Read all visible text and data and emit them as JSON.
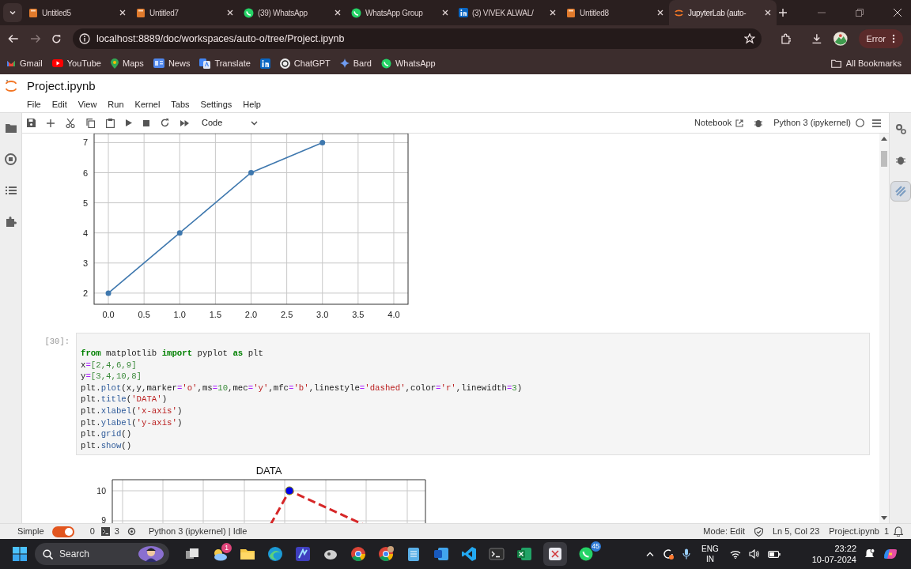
{
  "browser": {
    "tabs": [
      {
        "title": "Untitled5",
        "kind": "notebook",
        "selected": false
      },
      {
        "title": "Untitled7",
        "kind": "notebook",
        "selected": false
      },
      {
        "title": "(39) WhatsApp",
        "kind": "whatsapp",
        "selected": false
      },
      {
        "title": "WhatsApp Group",
        "kind": "whatsapp",
        "selected": false
      },
      {
        "title": "(3) VIVEK ALWAL/",
        "kind": "linkedin",
        "selected": false
      },
      {
        "title": "Untitled8",
        "kind": "notebook",
        "selected": false
      },
      {
        "title": "JupyterLab (auto-",
        "kind": "jupyter",
        "selected": true
      }
    ],
    "address": "localhost:8889/doc/workspaces/auto-o/tree/Project.ipynb",
    "profile_status": "Error",
    "bookmarks": [
      {
        "label": "Gmail",
        "kind": "gmail"
      },
      {
        "label": "YouTube",
        "kind": "youtube"
      },
      {
        "label": "Maps",
        "kind": "maps"
      },
      {
        "label": "News",
        "kind": "news"
      },
      {
        "label": "Translate",
        "kind": "translate"
      },
      {
        "kind": "linkedin"
      },
      {
        "label": "ChatGPT",
        "kind": "chatgpt"
      },
      {
        "label": "Bard",
        "kind": "bard"
      },
      {
        "label": "WhatsApp",
        "kind": "whatsapp"
      }
    ],
    "all_bookmarks": "All Bookmarks"
  },
  "jupyter": {
    "document_title": "Project.ipynb",
    "menu": [
      "File",
      "Edit",
      "View",
      "Run",
      "Kernel",
      "Tabs",
      "Settings",
      "Help"
    ],
    "toolbar": {
      "cell_type": "Code",
      "notebook_button": "Notebook",
      "kernel": "Python 3 (ipykernel)"
    },
    "cells": [
      {
        "kind": "output",
        "chart_data": {
          "type": "line",
          "x": [
            0,
            1,
            2,
            3
          ],
          "values": [
            2,
            4,
            6,
            7
          ],
          "xlim": [
            -0.2,
            4.2
          ],
          "ylim": [
            1.63,
            7.3
          ],
          "grid": true,
          "marker": "o",
          "xticks": [
            {
              "value": 0,
              "label": "0.0"
            },
            {
              "value": 0.5,
              "label": "0.5"
            },
            {
              "value": 1,
              "label": "1.0"
            },
            {
              "value": 1.5,
              "label": "1.5"
            },
            {
              "value": 2,
              "label": "2.0"
            },
            {
              "value": 2.5,
              "label": "2.5"
            },
            {
              "value": 3,
              "label": "3.0"
            },
            {
              "value": 3.5,
              "label": "3.5"
            },
            {
              "value": 4,
              "label": "4.0"
            }
          ],
          "yticks": [
            2,
            3,
            4,
            5,
            6,
            7
          ]
        }
      },
      {
        "kind": "code",
        "prompt": "[30]:",
        "lines": [
          [
            {
              "text": "from",
              "kind": "kw"
            },
            {
              "text": " matplotlib ",
              "kind": "plain"
            },
            {
              "text": "import",
              "kind": "kw"
            },
            {
              "text": " pyplot ",
              "kind": "plain"
            },
            {
              "text": "as",
              "kind": "kw"
            },
            {
              "text": " plt",
              "kind": "plain"
            }
          ],
          [
            {
              "text": "x",
              "kind": "plain"
            },
            {
              "text": "=",
              "kind": "op"
            },
            {
              "text": "[2,4,6,9]",
              "kind": "num"
            }
          ],
          [
            {
              "text": "y",
              "kind": "plain"
            },
            {
              "text": "=",
              "kind": "op"
            },
            {
              "text": "[3,4,10,8]",
              "kind": "num"
            }
          ],
          [
            {
              "text": "plt.",
              "kind": "plain"
            },
            {
              "text": "plot",
              "kind": "func"
            },
            {
              "text": "(x,y,marker",
              "kind": "plain"
            },
            {
              "text": "=",
              "kind": "op"
            },
            {
              "text": "'o'",
              "kind": "str"
            },
            {
              "text": ",ms",
              "kind": "plain"
            },
            {
              "text": "=",
              "kind": "op"
            },
            {
              "text": "10",
              "kind": "num"
            },
            {
              "text": ",mec",
              "kind": "plain"
            },
            {
              "text": "=",
              "kind": "op"
            },
            {
              "text": "'y'",
              "kind": "str"
            },
            {
              "text": ",mfc",
              "kind": "plain"
            },
            {
              "text": "=",
              "kind": "op"
            },
            {
              "text": "'b'",
              "kind": "str"
            },
            {
              "text": ",linestyle",
              "kind": "plain"
            },
            {
              "text": "=",
              "kind": "op"
            },
            {
              "text": "'dashed'",
              "kind": "str"
            },
            {
              "text": ",color",
              "kind": "plain"
            },
            {
              "text": "=",
              "kind": "op"
            },
            {
              "text": "'r'",
              "kind": "str"
            },
            {
              "text": ",linewidth",
              "kind": "plain"
            },
            {
              "text": "=",
              "kind": "op"
            },
            {
              "text": "3",
              "kind": "num"
            },
            {
              "text": ")",
              "kind": "plain"
            }
          ],
          [
            {
              "text": "plt.",
              "kind": "plain"
            },
            {
              "text": "title",
              "kind": "func"
            },
            {
              "text": "(",
              "kind": "plain"
            },
            {
              "text": "'DATA'",
              "kind": "str"
            },
            {
              "text": ")",
              "kind": "plain"
            }
          ],
          [
            {
              "text": "plt.",
              "kind": "plain"
            },
            {
              "text": "xlabel",
              "kind": "func"
            },
            {
              "text": "(",
              "kind": "plain"
            },
            {
              "text": "'x-axis'",
              "kind": "str"
            },
            {
              "text": ")",
              "kind": "plain"
            }
          ],
          [
            {
              "text": "plt.",
              "kind": "plain"
            },
            {
              "text": "ylabel",
              "kind": "func"
            },
            {
              "text": "(",
              "kind": "plain"
            },
            {
              "text": "'y-axis'",
              "kind": "str"
            },
            {
              "text": ")",
              "kind": "plain"
            }
          ],
          [
            {
              "text": "plt.",
              "kind": "plain"
            },
            {
              "text": "grid",
              "kind": "func"
            },
            {
              "text": "()",
              "kind": "plain"
            }
          ],
          [
            {
              "text": "plt.",
              "kind": "plain"
            },
            {
              "text": "show",
              "kind": "func"
            },
            {
              "text": "()",
              "kind": "plain"
            }
          ]
        ]
      },
      {
        "kind": "plot_preview",
        "title": "DATA",
        "y_tick_labels": [
          "10",
          "9"
        ]
      }
    ],
    "status_bar": {
      "simple_mode": {
        "label": "Simple",
        "on": true
      },
      "terminals": "0",
      "kernels": "3",
      "kernel_status": "Python 3 (ipykernel) | Idle",
      "mode": "Mode: Edit",
      "cursor": "Ln 5, Col 23",
      "file": "Project.ipynb",
      "notifications": "1"
    }
  },
  "taskbar": {
    "search_placeholder": "Search",
    "weather_badge": "1",
    "whatsapp_badge": "45",
    "language": "ENG",
    "region": "IN",
    "time": "23:22",
    "date": "10-07-2024"
  }
}
